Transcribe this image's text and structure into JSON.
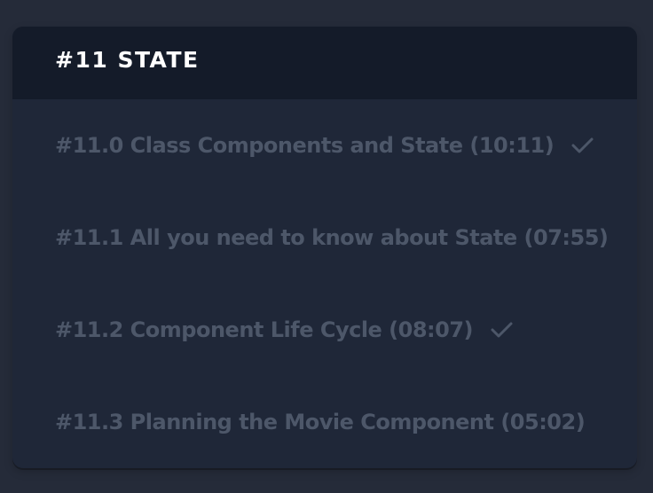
{
  "section": {
    "title": "#11 STATE"
  },
  "lessons": [
    {
      "label": "#11.0 Class Components and State (10:11)",
      "completed": true
    },
    {
      "label": "#11.1 All you need to know about State (07:55)",
      "completed": false
    },
    {
      "label": "#11.2 Component Life Cycle (08:07)",
      "completed": true
    },
    {
      "label": "#11.3 Planning the Movie Component (05:02)",
      "completed": false
    }
  ],
  "icons": {
    "completed": "check-icon"
  },
  "colors": {
    "page_background": "#252b39",
    "card_background": "#1f2738",
    "header_background": "#141b29",
    "title_text": "#ffffff",
    "lesson_text": "#4d5769"
  }
}
